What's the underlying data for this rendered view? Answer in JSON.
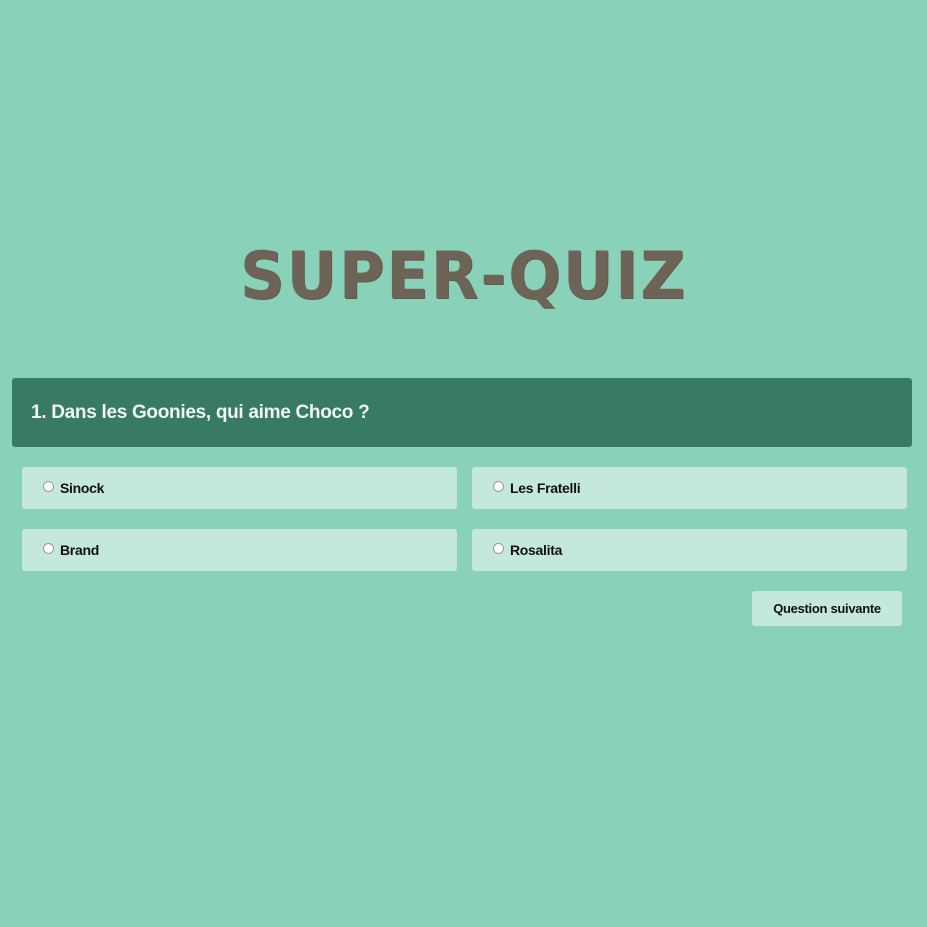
{
  "header": {
    "title": "SUPER-QUIZ"
  },
  "question": {
    "text": "1. Dans les Goonies, qui aime Choco ?"
  },
  "answers": [
    {
      "label": "Sinock",
      "selected": false
    },
    {
      "label": "Les Fratelli",
      "selected": false
    },
    {
      "label": "Brand",
      "selected": false
    },
    {
      "label": "Rosalita",
      "selected": false
    }
  ],
  "actions": {
    "next_label": "Question suivante"
  },
  "colors": {
    "background": "#89d1b8",
    "question_bar": "#387a63",
    "answer_card": "#c4e8dc",
    "title": "#6d6457"
  }
}
